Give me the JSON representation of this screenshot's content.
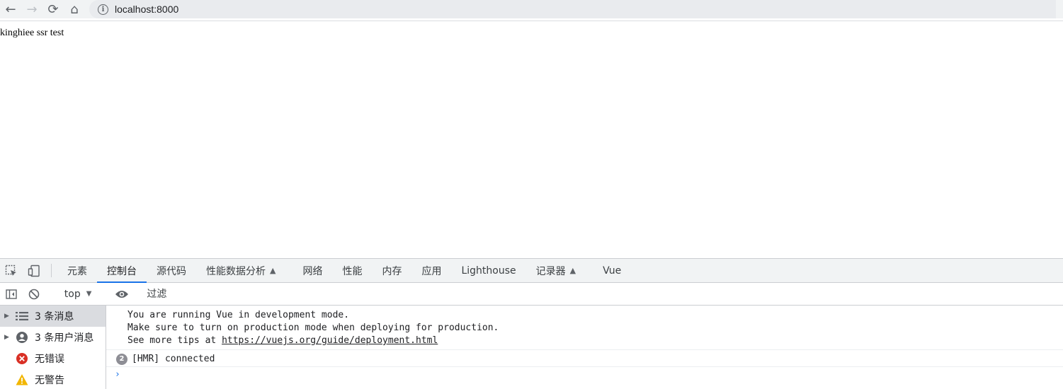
{
  "browser": {
    "back_glyph": "←",
    "forward_glyph": "→",
    "reload_glyph": "⟳",
    "home_glyph": "⌂",
    "info_glyph": "i",
    "url": "localhost:8000"
  },
  "page": {
    "body_text": "kinghiee ssr test"
  },
  "devtools": {
    "tabs": [
      {
        "label": "元素"
      },
      {
        "label": "控制台",
        "active": true
      },
      {
        "label": "源代码"
      },
      {
        "label": "性能数据分析"
      },
      {
        "label": "网络"
      },
      {
        "label": "性能"
      },
      {
        "label": "内存"
      },
      {
        "label": "应用"
      },
      {
        "label": "Lighthouse"
      },
      {
        "label": "记录器"
      },
      {
        "label": "Vue"
      }
    ],
    "toolbar": {
      "context": "top",
      "filter_placeholder": "过滤"
    },
    "sidebar": {
      "items": [
        {
          "label": "3 条消息",
          "icon": "list-icon"
        },
        {
          "label": "3 条用户消息",
          "icon": "user-icon"
        },
        {
          "label": "无错误",
          "icon": "error-icon"
        },
        {
          "label": "无警告",
          "icon": "warning-icon"
        }
      ]
    },
    "console": {
      "vue_line1": "You are running Vue in development mode.",
      "vue_line2": "Make sure to turn on production mode when deploying for production.",
      "vue_line3_prefix": "See more tips at ",
      "vue_line3_link": "https://vuejs.org/guide/deployment.html",
      "hmr_count": "2",
      "hmr_text": "[HMR] connected",
      "prompt": "›"
    },
    "colors": {
      "active_tab_underline": "#1a73e8",
      "error_red": "#d93025",
      "warning_yellow": "#f2b600"
    }
  }
}
